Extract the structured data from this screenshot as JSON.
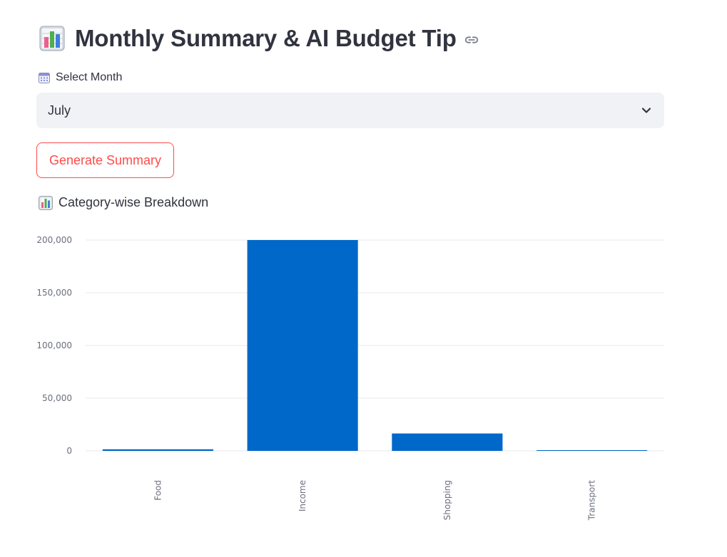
{
  "header": {
    "title": "Monthly Summary & AI Budget Tip",
    "title_icon": "bar-chart-emoji-icon",
    "anchor_icon": "link-icon"
  },
  "month_select": {
    "label": "Select Month",
    "label_icon": "calendar-icon",
    "value": "July"
  },
  "actions": {
    "generate_label": "Generate Summary"
  },
  "breakdown": {
    "label": "Category-wise Breakdown",
    "label_icon": "bar-chart-emoji-icon"
  },
  "colors": {
    "bar": "#0068c9",
    "accent": "#ff4b4b",
    "input_bg": "#f0f2f6",
    "text": "#31333f",
    "grid": "#e6e9ef"
  },
  "chart_data": {
    "type": "bar",
    "categories": [
      "Food",
      "Income",
      "Shopping",
      "Transport"
    ],
    "values": [
      1500,
      200000,
      16500,
      600
    ],
    "ylim": [
      0,
      200000
    ],
    "yticks": [
      0,
      50000,
      100000,
      150000,
      200000
    ],
    "ytick_labels": [
      "0",
      "50,000",
      "100,000",
      "150,000",
      "200,000"
    ],
    "xlabel": "",
    "ylabel": "",
    "grid": true,
    "legend": "none"
  }
}
